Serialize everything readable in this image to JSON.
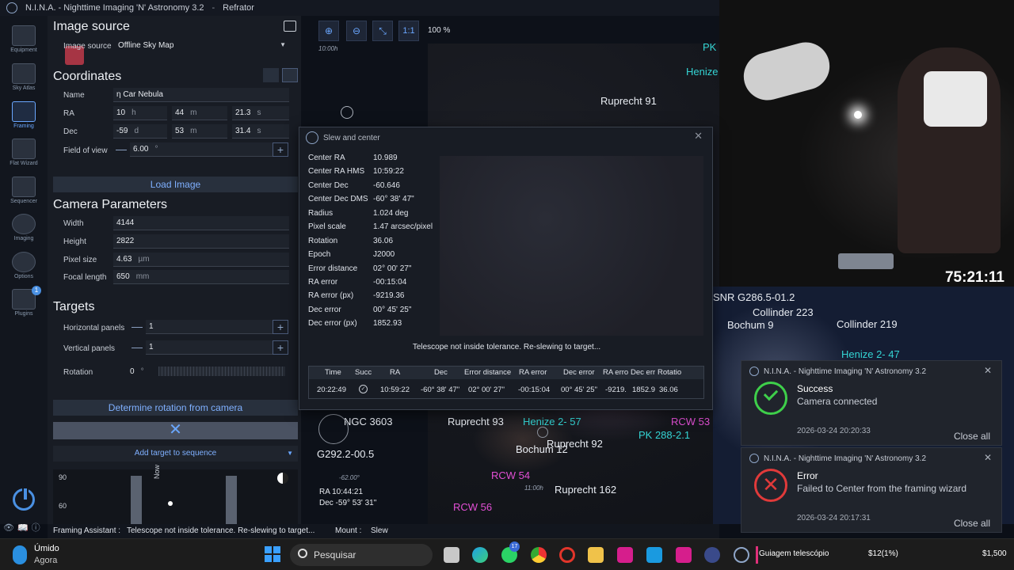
{
  "app": {
    "title": "N.I.N.A. - Nighttime Imaging 'N' Astronomy 3.2",
    "profile": "Refrator"
  },
  "sidebar": {
    "items": [
      {
        "label": "Equipment",
        "icon": "equipment-icon"
      },
      {
        "label": "Sky Atlas",
        "icon": "sky-atlas-icon"
      },
      {
        "label": "Framing",
        "icon": "framing-icon",
        "active": true
      },
      {
        "label": "Flat Wizard",
        "icon": "flat-wizard-icon"
      },
      {
        "label": "Sequencer",
        "icon": "sequencer-icon"
      },
      {
        "label": "Imaging",
        "icon": "imaging-icon"
      },
      {
        "label": "Options",
        "icon": "options-icon"
      },
      {
        "label": "Plugins",
        "icon": "plugins-icon",
        "badge": "1"
      }
    ],
    "collapse": "<<"
  },
  "image_source": {
    "title": "Image source",
    "label": "Image source",
    "value": "Offline Sky Map"
  },
  "coordinates": {
    "title": "Coordinates",
    "name_label": "Name",
    "name": "η Car Nebula",
    "ra_label": "RA",
    "ra_h": "10",
    "ra_h_unit": "h",
    "ra_m": "44",
    "ra_m_unit": "m",
    "ra_s": "21.3",
    "ra_s_unit": "s",
    "dec_label": "Dec",
    "dec_d": "-59",
    "dec_d_unit": "d",
    "dec_m": "53",
    "dec_m_unit": "m",
    "dec_s": "31.4",
    "dec_s_unit": "s",
    "fov_label": "Field of view",
    "fov": "6.00",
    "fov_unit": "°",
    "load_button": "Load Image"
  },
  "camera": {
    "title": "Camera Parameters",
    "width_label": "Width",
    "width": "4144",
    "height_label": "Height",
    "height": "2822",
    "pixel_label": "Pixel size",
    "pixel": "4.63",
    "pixel_unit": "µm",
    "focal_label": "Focal length",
    "focal": "650",
    "focal_unit": "mm"
  },
  "targets": {
    "title": "Targets",
    "hpanels_label": "Horizontal panels",
    "hpanels": "1",
    "vpanels_label": "Vertical panels",
    "vpanels": "1",
    "rotation_label": "Rotation",
    "rotation": "0",
    "rotation_unit": "°",
    "determine_button": "Determine rotation from camera",
    "add_button": "Add target to sequence",
    "alt_ticks": [
      "90",
      "60"
    ],
    "now_label": "Now"
  },
  "toolbar": {
    "zoom": "100 %",
    "one_to_one": "1:1"
  },
  "framing": {
    "time_label": "10:00h",
    "ra_readout": "RA 10:44:21",
    "dec_readout": "Dec -59° 53' 31\"",
    "labels": [
      {
        "text": "PK",
        "cls": "c"
      },
      {
        "text": "Henize",
        "cls": "c"
      },
      {
        "text": "Ruprecht 91",
        "cls": "w"
      },
      {
        "text": "NGC 3603",
        "cls": "w"
      },
      {
        "text": "Ruprecht 93",
        "cls": "w"
      },
      {
        "text": "Henize 2- 57",
        "cls": "c"
      },
      {
        "text": "RCW 53",
        "cls": "m"
      },
      {
        "text": "PK 288-2.1",
        "cls": "c"
      },
      {
        "text": "G292.2-00.5",
        "cls": "w"
      },
      {
        "text": "Bochum 12",
        "cls": "w"
      },
      {
        "text": "Ruprecht 92",
        "cls": "w"
      },
      {
        "text": "RCW 54",
        "cls": "m"
      },
      {
        "text": "Ruprecht 162",
        "cls": "w"
      },
      {
        "text": "RCW 56",
        "cls": "m"
      }
    ],
    "grid_labels": [
      "-62.00°",
      "11:00h"
    ]
  },
  "dialog": {
    "title": "Slew and center",
    "rows": [
      {
        "label": "Center RA",
        "value": "10.989"
      },
      {
        "label": "Center RA HMS",
        "value": "10:59:22"
      },
      {
        "label": "Center Dec",
        "value": "-60.646"
      },
      {
        "label": "Center Dec DMS",
        "value": "-60° 38' 47\""
      },
      {
        "label": "Radius",
        "value": "1.024 deg"
      },
      {
        "label": "Pixel scale",
        "value": "1.47 arcsec/pixel"
      },
      {
        "label": "Rotation",
        "value": "36.06"
      },
      {
        "label": "Epoch",
        "value": "J2000"
      },
      {
        "label": "Error distance",
        "value": "02° 00' 27\""
      },
      {
        "label": "RA error",
        "value": "-00:15:04"
      },
      {
        "label": "RA error (px)",
        "value": "-9219.36"
      },
      {
        "label": "Dec error",
        "value": "00° 45' 25\""
      },
      {
        "label": "Dec error (px)",
        "value": "1852.93"
      }
    ],
    "message": "Telescope not inside tolerance. Re-slewing to target...",
    "table_headers": [
      "Time",
      "Succ",
      "RA",
      "Dec",
      "Error distance",
      "RA error",
      "Dec error",
      "RA erro",
      "Dec err",
      "Rotatio"
    ],
    "table_row": [
      "20:22:49",
      "",
      "10:59:22",
      "-60° 38' 47\"",
      "02° 00' 27\"",
      "-00:15:04",
      "00° 45' 25\"",
      "-9219.",
      "1852.9",
      "36.06"
    ]
  },
  "webcam": {
    "timer": "75:21:11"
  },
  "right_sky": {
    "labels": [
      {
        "text": "SNR G286.5-01.2",
        "cls": "w"
      },
      {
        "text": "Collinder 223",
        "cls": "w"
      },
      {
        "text": "Bochum 9",
        "cls": "w"
      },
      {
        "text": "Collinder 219",
        "cls": "w"
      },
      {
        "text": "Henize 2- 47",
        "cls": "c"
      }
    ]
  },
  "toasts": [
    {
      "app": "N.I.N.A. - Nighttime Imaging 'N' Astronomy 3.2",
      "title": "Success",
      "message": "Camera connected",
      "date": "2026-03-24 20:20:33",
      "close_all": "Close all",
      "color": "#3ecf4a"
    },
    {
      "app": "N.I.N.A. - Nighttime Imaging 'N' Astronomy 3.2",
      "title": "Error",
      "message": "Failed to Center from the framing wizard",
      "date": "2026-03-24 20:17:31",
      "close_all": "Close all",
      "color": "#e03a3a"
    }
  ],
  "status": {
    "framing_label": "Framing Assistant :",
    "framing_value": "Telescope not inside tolerance. Re-slewing to target...",
    "mount_label": "Mount :",
    "mount_value": "Slew"
  },
  "taskbar": {
    "weather_title": "Úmido",
    "weather_sub": "Agora",
    "search": "Pesquisar",
    "whatsapp_badge": "17",
    "active_window": "Guiagem telescópio",
    "ticker1": "$12(1%)",
    "ticker2": "$1,500"
  }
}
